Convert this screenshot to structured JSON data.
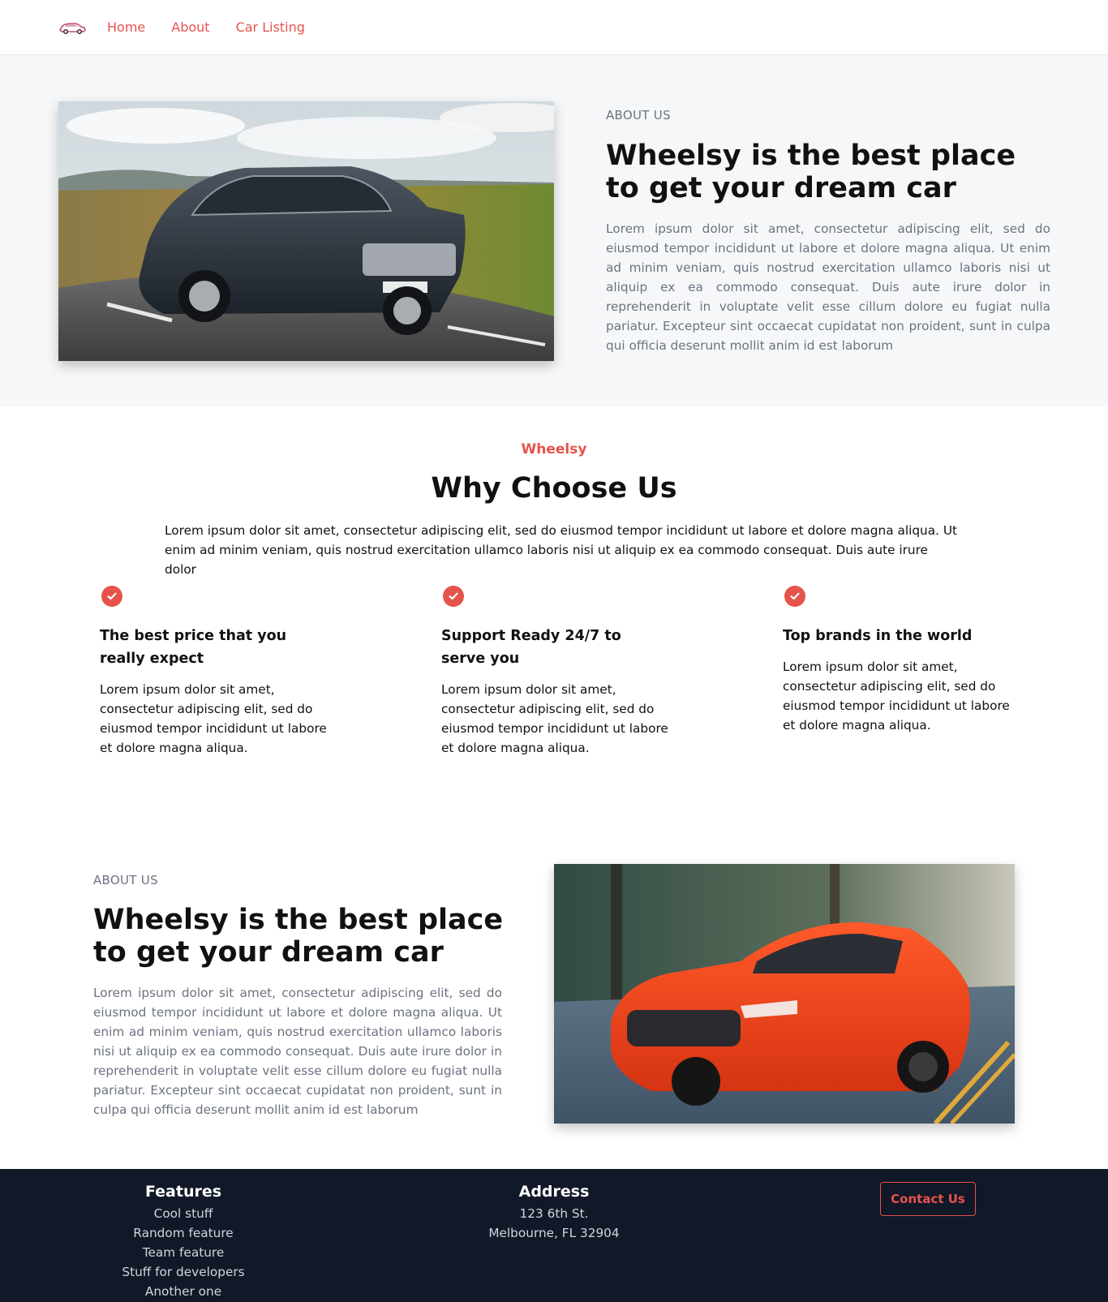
{
  "nav": {
    "links": [
      "Home",
      "About",
      "Car Listing"
    ]
  },
  "about_top": {
    "eyebrow": "ABOUT US",
    "heading": "Wheelsy is the best place to get your dream car",
    "body": "Lorem ipsum dolor sit amet, consectetur adipiscing elit, sed do eiusmod tempor incididunt ut labore et dolore magna aliqua. Ut enim ad minim veniam, quis nostrud exercitation ullamco laboris nisi ut aliquip ex ea commodo consequat. Duis aute irure dolor in reprehenderit in voluptate velit esse cillum dolore eu fugiat nulla pariatur. Excepteur sint occaecat cupidatat non proident, sunt in culpa qui officia deserunt mollit anim id est laborum"
  },
  "why": {
    "tag": "Wheelsy",
    "title": "Why Choose Us",
    "description": "Lorem ipsum dolor sit amet, consectetur adipiscing elit, sed do eiusmod tempor incididunt ut labore et dolore magna aliqua. Ut enim ad minim veniam, quis nostrud exercitation ullamco laboris nisi ut aliquip ex ea commodo consequat. Duis aute irure dolor",
    "features": [
      {
        "title": "The best price that you really expect",
        "text": "Lorem ipsum dolor sit amet, consectetur adipiscing elit, sed do eiusmod tempor incididunt ut labore et dolore magna aliqua."
      },
      {
        "title": "Support Ready 24/7 to serve you",
        "text": "Lorem ipsum dolor sit amet, consectetur adipiscing elit, sed do eiusmod tempor incididunt ut labore et dolore magna aliqua."
      },
      {
        "title": "Top brands in the world",
        "text": "Lorem ipsum dolor sit amet, consectetur adipiscing elit, sed do eiusmod tempor incididunt ut labore et dolore magna aliqua."
      }
    ]
  },
  "about_bottom": {
    "eyebrow": "ABOUT US",
    "heading": "Wheelsy is the best place to get your dream car",
    "body": "Lorem ipsum dolor sit amet, consectetur adipiscing elit, sed do eiusmod tempor incididunt ut labore et dolore magna aliqua. Ut enim ad minim veniam, quis nostrud exercitation ullamco laboris nisi ut aliquip ex ea commodo consequat. Duis aute irure dolor in reprehenderit in voluptate velit esse cillum dolore eu fugiat nulla pariatur. Excepteur sint occaecat cupidatat non proident, sunt in culpa qui officia deserunt mollit anim id est laborum"
  },
  "footer": {
    "features_title": "Features",
    "features_items": [
      "Cool stuff",
      "Random feature",
      "Team feature",
      "Stuff for developers",
      "Another one"
    ],
    "address_title": "Address",
    "address_lines": [
      "123 6th St.",
      "Melbourne, FL 32904"
    ],
    "contact_label": "Contact Us"
  },
  "colors": {
    "accent": "#e5534b",
    "footer_bg": "#111827",
    "section_bg": "#f6f7f9"
  }
}
